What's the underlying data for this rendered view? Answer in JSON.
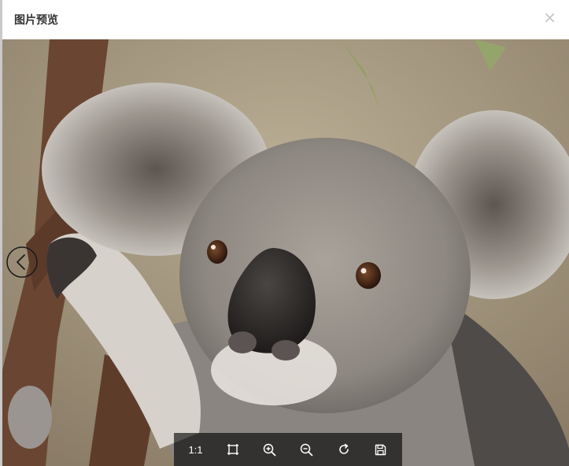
{
  "dialog": {
    "title": "图片预览",
    "close_glyph": "×"
  },
  "viewer": {
    "image_subject": "koala",
    "prev_icon": "chevron-left-circle-icon"
  },
  "toolbar": {
    "actual_size_label": "1:1",
    "fit_icon": "fit-screen-icon",
    "zoom_in_icon": "zoom-in-icon",
    "zoom_out_icon": "zoom-out-icon",
    "rotate_icon": "rotate-icon",
    "save_icon": "save-icon"
  },
  "colors": {
    "toolbar_bg": "#000000",
    "header_text": "#333333",
    "close": "#c4c4c4"
  }
}
